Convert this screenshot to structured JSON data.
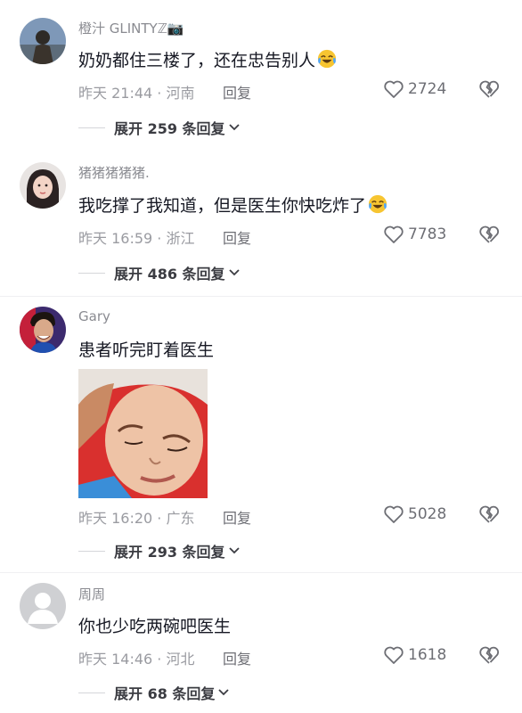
{
  "comments": [
    {
      "username": "橙汁 GLINTYℤ📷",
      "text": "奶奶都住三楼了，还在忠告别人",
      "emoji": "laughing-crying-icon",
      "meta": "昨天 21:44 · 河南",
      "reply_label": "回复",
      "likes": "2724",
      "expand_label": "展开 259 条回复"
    },
    {
      "username": "猪猪猪猪猪.",
      "text": "我吃撑了我知道，但是医生你快吃炸了",
      "emoji": "laughing-crying-icon",
      "meta": "昨天 16:59 · 浙江",
      "reply_label": "回复",
      "likes": "7783",
      "expand_label": "展开 486 条回复"
    },
    {
      "username": "Gary",
      "text": "患者听完盯着医生",
      "meta": "昨天 16:20 · 广东",
      "reply_label": "回复",
      "likes": "5028",
      "expand_label": "展开 293 条回复"
    },
    {
      "username": "周周",
      "text": "你也少吃两碗吧医生",
      "meta": "昨天 14:46 · 河北",
      "reply_label": "回复",
      "likes": "1618",
      "expand_label": "展开 68 条回复"
    }
  ],
  "icons": {
    "like": "heart-outline-icon",
    "dislike": "broken-heart-icon",
    "expand": "chevron-down-icon"
  },
  "colors": {
    "text": "#161823",
    "muted": "#8a8b91",
    "expand": "#3b3c42"
  }
}
